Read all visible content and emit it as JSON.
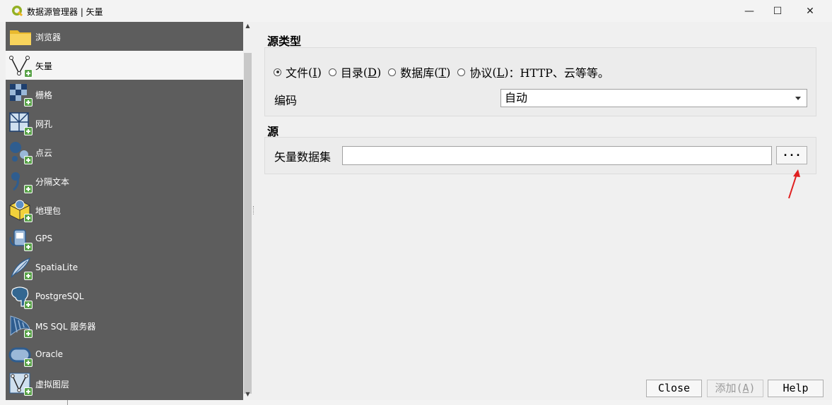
{
  "window": {
    "title": "数据源管理器 | 矢量",
    "minimize_symbol": "—",
    "maximize_symbol": "☐",
    "close_symbol": "✕"
  },
  "sidebar": {
    "items": [
      {
        "label": "浏览器",
        "icon": "folder-icon",
        "selected": false
      },
      {
        "label": "矢量",
        "icon": "vector-icon",
        "selected": true
      },
      {
        "label": "栅格",
        "icon": "raster-icon",
        "selected": false
      },
      {
        "label": "网孔",
        "icon": "mesh-icon",
        "selected": false
      },
      {
        "label": "点云",
        "icon": "point-cloud-icon",
        "selected": false
      },
      {
        "label": "分隔文本",
        "icon": "delimited-text-icon",
        "selected": false
      },
      {
        "label": "地理包",
        "icon": "geopackage-icon",
        "selected": false
      },
      {
        "label": "GPS",
        "icon": "gps-icon",
        "selected": false
      },
      {
        "label": "SpatiaLite",
        "icon": "spatialite-icon",
        "selected": false
      },
      {
        "label": "PostgreSQL",
        "icon": "postgresql-icon",
        "selected": false
      },
      {
        "label": "MS SQL 服务器",
        "icon": "mssql-icon",
        "selected": false
      },
      {
        "label": "Oracle",
        "icon": "oracle-icon",
        "selected": false
      },
      {
        "label": "虚拟图层",
        "icon": "virtual-layer-icon",
        "selected": false
      }
    ]
  },
  "source_type": {
    "title": "源类型",
    "options": [
      {
        "text": "文件",
        "key": "I",
        "selected": true
      },
      {
        "text": "目录",
        "key": "D",
        "selected": false
      },
      {
        "text": "数据库",
        "key": "T",
        "selected": false
      },
      {
        "text": "协议",
        "key": "L",
        "suffix": "：HTTP、云等等。",
        "selected": false
      }
    ],
    "encoding_label": "编码",
    "encoding_value": "自动"
  },
  "source": {
    "title": "源",
    "dataset_label": "矢量数据集",
    "dataset_value": "",
    "browse_label": "···"
  },
  "footer": {
    "close_label": "Close",
    "add_label": "添加",
    "add_key": "A",
    "help_label": "Help"
  },
  "colors": {
    "sidebar_bg": "#5d5d5d",
    "selected_bg": "#f5f5f5",
    "annotation_arrow": "#e02020",
    "plus_badge": "#5aa34a"
  }
}
